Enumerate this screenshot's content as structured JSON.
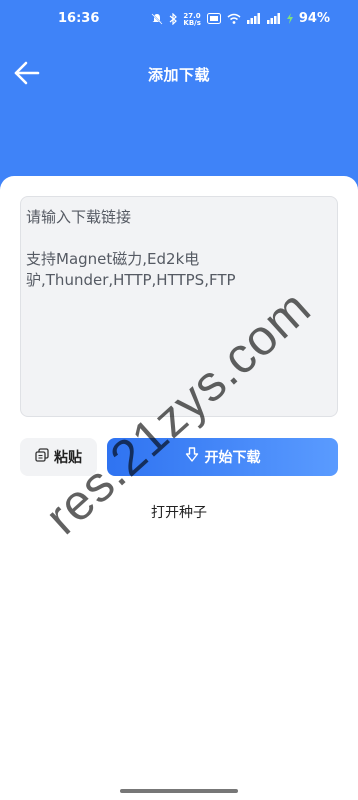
{
  "status_bar": {
    "time": "16:36",
    "net_speed": "27.0\nKB/s",
    "battery": "94%"
  },
  "app_bar": {
    "title": "添加下载",
    "back_icon": "arrow-left-icon"
  },
  "input": {
    "placeholder_line1": "请输入下载链接",
    "placeholder_line2": "支持Magnet磁力,Ed2k电驴,Thunder,HTTP,HTTPS,FTP"
  },
  "actions": {
    "paste_label": "粘贴",
    "paste_icon": "copy-icon",
    "start_label": "开始下载",
    "start_icon": "download-arrow-icon",
    "open_seed_label": "打开种子"
  },
  "watermark": "res.21zys.com",
  "colors": {
    "primary": "#3f83f8",
    "button_gradient_start": "#2f73f1",
    "button_gradient_end": "#5a9bff"
  }
}
